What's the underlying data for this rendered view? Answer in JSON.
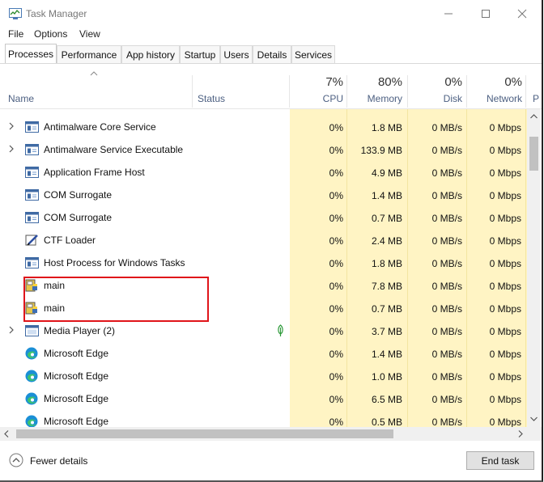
{
  "window": {
    "title": "Task Manager",
    "controls": {
      "minimize": "—",
      "maximize": "☐",
      "close": "✕"
    }
  },
  "menu": [
    "File",
    "Options",
    "View"
  ],
  "tabs": [
    "Processes",
    "Performance",
    "App history",
    "Startup",
    "Users",
    "Details",
    "Services"
  ],
  "active_tab": "Processes",
  "columns": {
    "name": "Name",
    "status": "Status",
    "cpu": {
      "percent": "7%",
      "label": "CPU"
    },
    "memory": {
      "percent": "80%",
      "label": "Memory"
    },
    "disk": {
      "percent": "0%",
      "label": "Disk"
    },
    "network": {
      "percent": "0%",
      "label": "Network"
    },
    "truncated": "P"
  },
  "rows": [
    {
      "name": "Antimalware Core Service",
      "expandable": true,
      "icon": "service-window-icon",
      "cpu": "0%",
      "memory": "1.8 MB",
      "disk": "0 MB/s",
      "network": "0 Mbps"
    },
    {
      "name": "Antimalware Service Executable",
      "expandable": true,
      "icon": "service-window-icon",
      "cpu": "0%",
      "memory": "133.9 MB",
      "disk": "0 MB/s",
      "network": "0 Mbps"
    },
    {
      "name": "Application Frame Host",
      "expandable": false,
      "icon": "service-window-icon",
      "cpu": "0%",
      "memory": "4.9 MB",
      "disk": "0 MB/s",
      "network": "0 Mbps"
    },
    {
      "name": "COM Surrogate",
      "expandable": false,
      "icon": "service-window-icon",
      "cpu": "0%",
      "memory": "1.4 MB",
      "disk": "0 MB/s",
      "network": "0 Mbps"
    },
    {
      "name": "COM Surrogate",
      "expandable": false,
      "icon": "service-window-icon",
      "cpu": "0%",
      "memory": "0.7 MB",
      "disk": "0 MB/s",
      "network": "0 Mbps"
    },
    {
      "name": "CTF Loader",
      "expandable": false,
      "icon": "ctf-pen-icon",
      "cpu": "0%",
      "memory": "2.4 MB",
      "disk": "0 MB/s",
      "network": "0 Mbps"
    },
    {
      "name": "Host Process for Windows Tasks",
      "expandable": false,
      "icon": "service-window-icon",
      "cpu": "0%",
      "memory": "1.8 MB",
      "disk": "0 MB/s",
      "network": "0 Mbps"
    },
    {
      "name": "main",
      "expandable": false,
      "icon": "python-icon",
      "cpu": "0%",
      "memory": "7.8 MB",
      "disk": "0 MB/s",
      "network": "0 Mbps"
    },
    {
      "name": "main",
      "expandable": false,
      "icon": "python-icon",
      "cpu": "0%",
      "memory": "0.7 MB",
      "disk": "0 MB/s",
      "network": "0 Mbps"
    },
    {
      "name": "Media Player (2)",
      "expandable": true,
      "icon": "media-player-icon",
      "status_icon": "leaf-icon",
      "cpu": "0%",
      "memory": "3.7 MB",
      "disk": "0 MB/s",
      "network": "0 Mbps"
    },
    {
      "name": "Microsoft Edge",
      "expandable": false,
      "icon": "edge-icon",
      "cpu": "0%",
      "memory": "1.4 MB",
      "disk": "0 MB/s",
      "network": "0 Mbps"
    },
    {
      "name": "Microsoft Edge",
      "expandable": false,
      "icon": "edge-icon",
      "cpu": "0%",
      "memory": "1.0 MB",
      "disk": "0 MB/s",
      "network": "0 Mbps"
    },
    {
      "name": "Microsoft Edge",
      "expandable": false,
      "icon": "edge-icon",
      "cpu": "0%",
      "memory": "6.5 MB",
      "disk": "0 MB/s",
      "network": "0 Mbps"
    },
    {
      "name": "Microsoft Edge",
      "expandable": false,
      "icon": "edge-icon",
      "cpu": "0%",
      "memory": "0.5 MB",
      "disk": "0 MB/s",
      "network": "0 Mbps"
    }
  ],
  "highlight_color": "#e0141a",
  "heat_color": "#fff4c4",
  "footer": {
    "fewer_details": "Fewer details",
    "end_task": "End task"
  }
}
